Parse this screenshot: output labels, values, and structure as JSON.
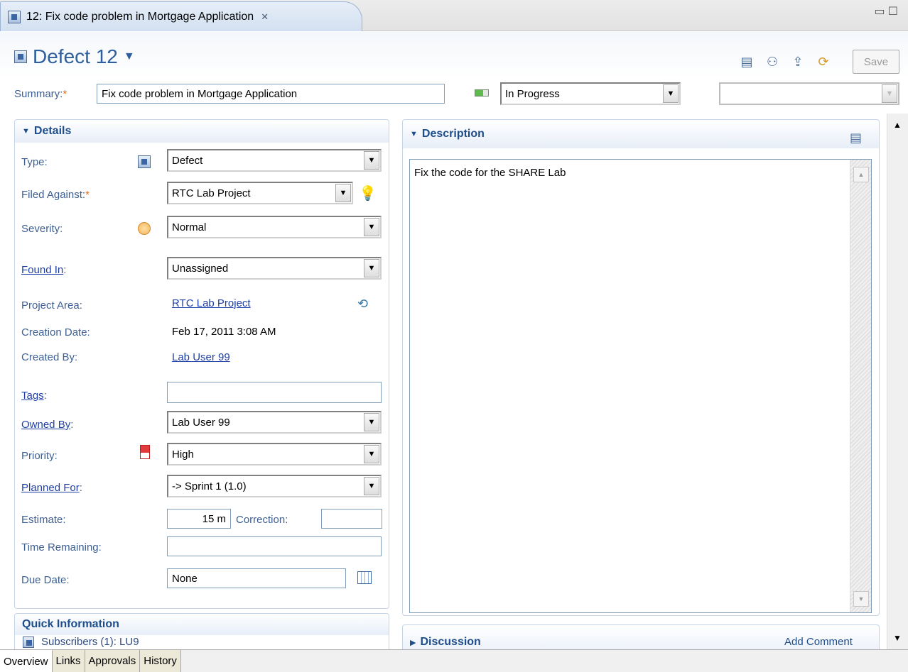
{
  "editor_tab": {
    "title": "12: Fix code problem in Mortgage Application"
  },
  "header": {
    "title": "Defect 12",
    "save_label": "Save",
    "summary_label": "Summary:",
    "summary_value": "Fix code problem in Mortgage Application",
    "state_value": "In Progress",
    "resolution_value": ""
  },
  "details": {
    "section_title": "Details",
    "type_label": "Type:",
    "type_value": "Defect",
    "filed_against_label": "Filed Against:",
    "filed_against_value": "RTC Lab Project",
    "severity_label": "Severity:",
    "severity_value": "Normal",
    "found_in_label": "Found In",
    "found_in_value": "Unassigned",
    "project_area_label": "Project Area:",
    "project_area_value": "RTC Lab Project",
    "creation_date_label": "Creation Date:",
    "creation_date_value": "Feb 17, 2011 3:08 AM",
    "created_by_label": "Created By:",
    "created_by_value": "Lab User 99",
    "tags_label": "Tags",
    "tags_value": "",
    "owned_by_label": "Owned By",
    "owned_by_value": "Lab User 99",
    "priority_label": "Priority:",
    "priority_value": "High",
    "planned_for_label": "Planned For",
    "planned_for_value": "-> Sprint 1 (1.0)",
    "estimate_label": "Estimate:",
    "estimate_value": "15 m",
    "correction_label": "Correction:",
    "correction_value": "",
    "time_remaining_label": "Time Remaining:",
    "time_remaining_value": "",
    "due_date_label": "Due Date:",
    "due_date_value": "None"
  },
  "quick_info": {
    "title": "Quick Information",
    "subscribers_text": "Subscribers (1): LU9"
  },
  "description": {
    "title": "Description",
    "text": "Fix the code for the SHARE Lab"
  },
  "discussion": {
    "title": "Discussion",
    "add_comment": "Add Comment"
  },
  "bottom_tabs": [
    "Overview",
    "Links",
    "Approvals",
    "History"
  ]
}
